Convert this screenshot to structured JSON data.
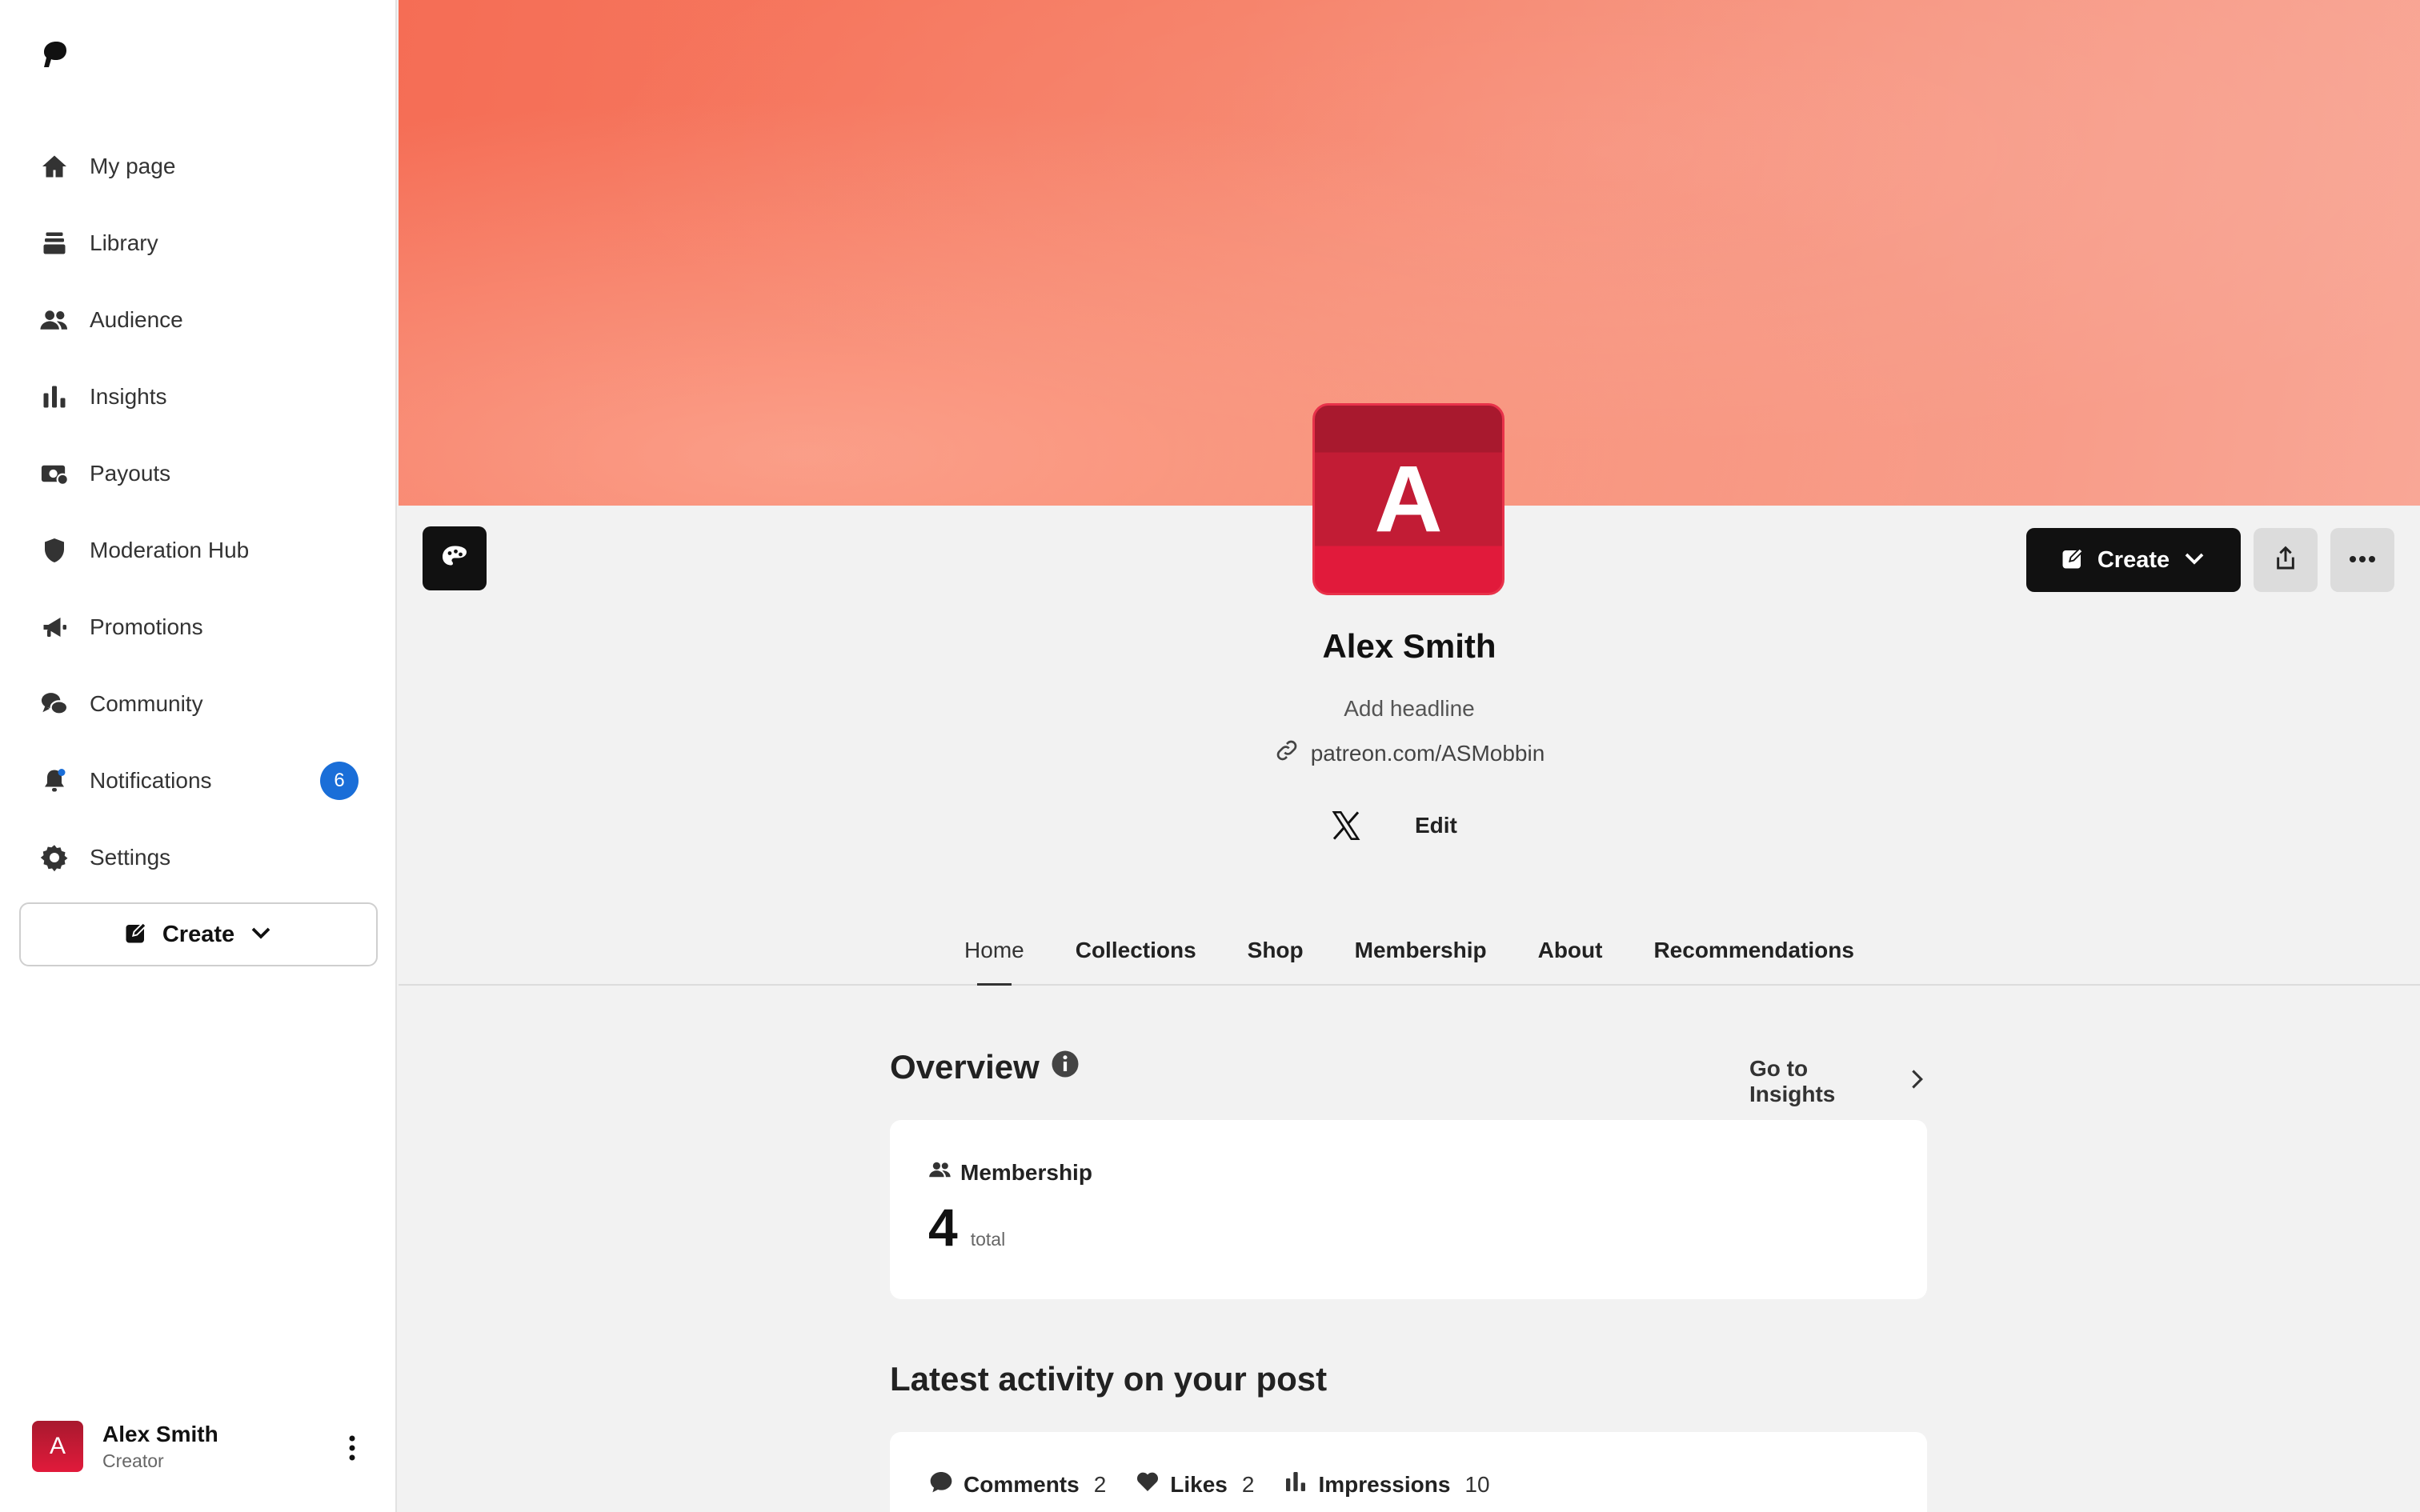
{
  "sidebar": {
    "nav": [
      {
        "label": "My page",
        "icon": "home-icon"
      },
      {
        "label": "Library",
        "icon": "library-icon"
      },
      {
        "label": "Audience",
        "icon": "audience-icon"
      },
      {
        "label": "Insights",
        "icon": "bar-chart-icon"
      },
      {
        "label": "Payouts",
        "icon": "payouts-icon"
      },
      {
        "label": "Moderation Hub",
        "icon": "shield-icon"
      },
      {
        "label": "Promotions",
        "icon": "megaphone-icon"
      },
      {
        "label": "Community",
        "icon": "chat-bubbles-icon"
      },
      {
        "label": "Notifications",
        "icon": "bell-icon",
        "badge": "6"
      },
      {
        "label": "Settings",
        "icon": "gear-icon"
      }
    ],
    "create_label": "Create",
    "user": {
      "initial": "A",
      "name": "Alex Smith",
      "role": "Creator"
    }
  },
  "profile": {
    "avatar_initial": "A",
    "name": "Alex Smith",
    "headline_placeholder": "Add headline",
    "link": "patreon.com/ASMobbin",
    "edit_label": "Edit",
    "create_label": "Create"
  },
  "tabs": [
    {
      "label": "Home",
      "active": true
    },
    {
      "label": "Collections",
      "active": false
    },
    {
      "label": "Shop",
      "active": false
    },
    {
      "label": "Membership",
      "active": false
    },
    {
      "label": "About",
      "active": false
    },
    {
      "label": "Recommendations",
      "active": false
    }
  ],
  "overview": {
    "title": "Overview",
    "goto_label": "Go to Insights",
    "membership": {
      "label": "Membership",
      "value": "4",
      "unit": "total"
    }
  },
  "activity": {
    "title": "Latest activity on your post",
    "stats": [
      {
        "label": "Comments",
        "value": "2",
        "icon": "comment-icon"
      },
      {
        "label": "Likes",
        "value": "2",
        "icon": "heart-icon"
      },
      {
        "label": "Impressions",
        "value": "10",
        "icon": "bar-chart-icon"
      }
    ]
  },
  "colors": {
    "banner": "#f67f66",
    "avatar": "#c21c35",
    "badge": "#1a6ed8",
    "primary_button": "#111111"
  }
}
